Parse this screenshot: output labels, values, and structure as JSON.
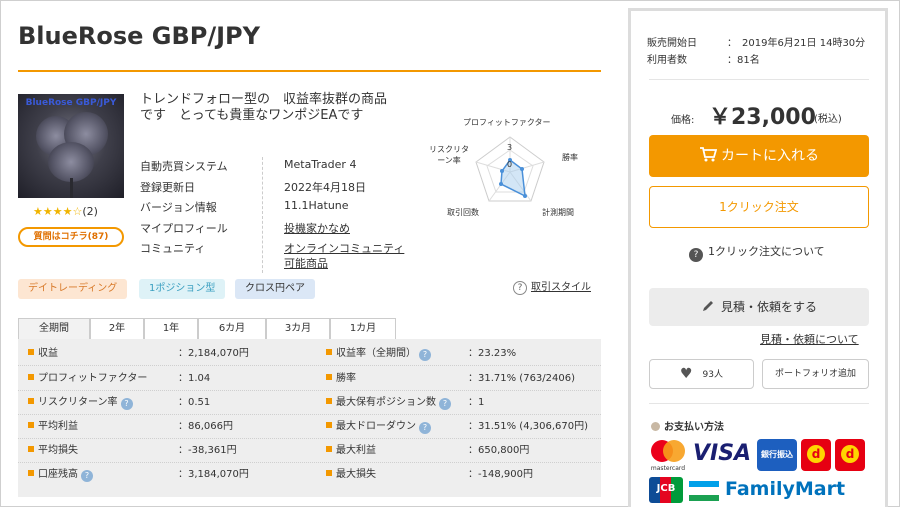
{
  "product": {
    "title": "BlueRose GBP/JPY",
    "image_label": "BlueRose GBP/JPY",
    "rating_stars": "★★★★☆",
    "rating_count": "(2)",
    "rating_value": 4,
    "question_button": "質問はコチラ(87)",
    "description": "トレンドフォロー型の　収益率抜群の商品です　とっても貴重なワンポジEAです"
  },
  "specs": [
    {
      "key": "自動売買システム",
      "value": "MetaTrader 4",
      "link": false
    },
    {
      "key": "登録更新日",
      "value": "2022年4月18日",
      "link": false
    },
    {
      "key": "バージョン情報",
      "value": "11.1Hatune",
      "link": false
    },
    {
      "key": "マイプロフィール",
      "value": "投機家かなめ",
      "link": true
    },
    {
      "key": "コミュニティ",
      "value": "オンラインコミュニティ",
      "link": true
    },
    {
      "key": "",
      "value": "可能商品",
      "link": true
    }
  ],
  "radar": {
    "labels": [
      "プロフィットファクター",
      "勝率",
      "計測期間",
      "取引回数",
      "リスクリターン率"
    ],
    "scale_max": "3",
    "scale_zero": "0"
  },
  "tags": [
    "デイトレーディング",
    "1ポジション型",
    "クロス円ペア"
  ],
  "trade_style_link": "取引スタイル",
  "tabs": [
    "全期間",
    "2年",
    "1年",
    "6カ月",
    "3カ月",
    "1カ月"
  ],
  "stats_left": [
    {
      "label": "収益",
      "value": "：2,184,070円",
      "help": false
    },
    {
      "label": "プロフィットファクター",
      "value": "：1.04",
      "help": false
    },
    {
      "label": "リスクリターン率",
      "value": "：0.51",
      "help": true
    },
    {
      "label": "平均利益",
      "value": "：86,066円",
      "help": false
    },
    {
      "label": "平均損失",
      "value": "：-38,361円",
      "help": false
    },
    {
      "label": "口座残高",
      "value": "：3,184,070円",
      "help": true
    }
  ],
  "stats_right": [
    {
      "label": "収益率（全期間）",
      "value": "：23.23%",
      "help": true
    },
    {
      "label": "勝率",
      "value": "：31.71% (763/2406)",
      "help": false
    },
    {
      "label": "最大保有ポジション数",
      "value": "：1",
      "help": true
    },
    {
      "label": "最大ドローダウン",
      "value": "：31.51% (4,306,670円)",
      "help": true
    },
    {
      "label": "最大利益",
      "value": "：650,800円",
      "help": false
    },
    {
      "label": "最大損失",
      "value": "：-148,900円",
      "help": false
    }
  ],
  "sidebar": {
    "sale_start_label": "販売開始日",
    "sale_start_value": "：　2019年6月21日 14時30分",
    "users_label": "利用者数",
    "users_value": "：81名",
    "price_label": "価格:",
    "price_value": "￥23,000",
    "tax_label": "(税込)",
    "cart_button": "カートに入れる",
    "one_click_button": "1クリック注文",
    "one_click_about": "1クリック注文について",
    "estimate_button": "見積・依頼をする",
    "estimate_about": "見積・依頼について",
    "likes": "93人",
    "portfolio_button": "ポートフォリオ追加",
    "payment_title": "お支払い方法",
    "payment_logos": {
      "mastercard": "mastercard",
      "visa": "VISA",
      "bank": "銀行振込",
      "jcb": "JCB",
      "familymart": "FamilyMart"
    }
  },
  "colors": {
    "accent": "#f39800",
    "stats_bg": "#eeeeee",
    "tag_day": "#fde6d2",
    "tag_pos": "#def2f7",
    "tag_cross": "#dbe7f6"
  }
}
